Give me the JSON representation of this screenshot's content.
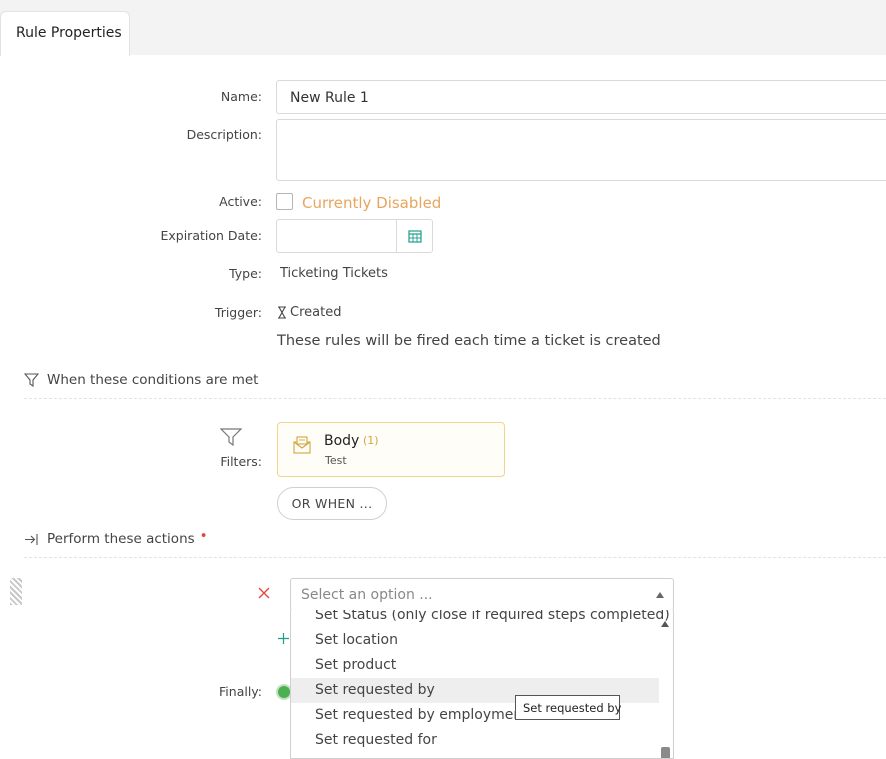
{
  "tabs": [
    {
      "label": "Rule Properties"
    }
  ],
  "form": {
    "name_label": "Name:",
    "name_value": "New Rule 1",
    "description_label": "Description:",
    "description_value": "",
    "active_label": "Active:",
    "active_status": "Currently Disabled",
    "expiration_label": "Expiration Date:",
    "expiration_value": "",
    "type_label": "Type:",
    "type_value": "Ticketing Tickets",
    "trigger_label": "Trigger:",
    "trigger_value": "Created",
    "trigger_desc": "These rules will be fired each time a ticket is created"
  },
  "conditions": {
    "heading": "When these conditions are met",
    "filters_label": "Filters:",
    "filter_card": {
      "title": "Body",
      "count": "(1)",
      "sub": "Test"
    },
    "or_when_label": "OR WHEN ..."
  },
  "actions": {
    "heading": "Perform these actions",
    "required_mark": "•",
    "select_placeholder": "Select an option ...",
    "options": [
      "Set Status (only close if required steps completed)",
      "Set location",
      "Set product",
      "Set requested by",
      "Set requested by employment",
      "Set requested for"
    ],
    "highlighted_index": 3,
    "tooltip": "Set requested by",
    "finally_label": "Finally:"
  },
  "colors": {
    "accent_orange": "#e8a55d",
    "remove_red": "#e0443a",
    "teal": "#1a9e8a",
    "green": "#4caf50"
  }
}
